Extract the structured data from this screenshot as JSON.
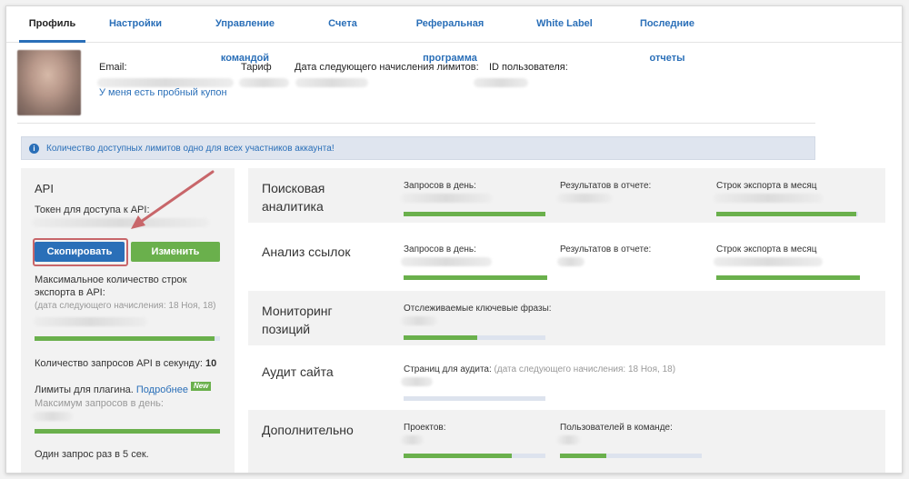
{
  "tabs": [
    {
      "label": "Профиль",
      "active": true
    },
    {
      "label": "Настройки"
    },
    {
      "label": "Управление командой"
    },
    {
      "label": "Счета"
    },
    {
      "label": "Реферальная программа"
    },
    {
      "label": "White Label"
    },
    {
      "label": "Последние отчеты"
    }
  ],
  "profile": {
    "email_label": "Email:",
    "plan_label": "Тариф",
    "next_limits_label": "Дата следующего начисления лимитов:",
    "user_id_label": "ID пользователя:",
    "coupon_link": "У меня есть пробный купон"
  },
  "info": {
    "text": "Количество доступных лимитов одно для всех участников аккаунта!"
  },
  "api": {
    "title": "API",
    "token_label": "Токен для доступа к API:",
    "copy_button": "Скопировать",
    "change_button": "Изменить",
    "max_rows_label_1": "Максимальное количество строк",
    "max_rows_label_2": "экспорта в API:",
    "next_accrual": "(дата следующего начисления: 18 Ноя, 18)",
    "max_rows_progress": 0.97,
    "rps_label": "Количество запросов API в секунду:",
    "rps_value": "10",
    "plugin_label": "Лимиты для плагина.",
    "plugin_link": "Подробнее",
    "plugin_badge": "New",
    "plugin_max_label": "Максимум запросов в день:",
    "plugin_progress": 1.0,
    "rate_text": "Один запрос раз в 5 сек."
  },
  "rows": {
    "search": {
      "title_1": "Поисковая",
      "title_2": "аналитика",
      "c1": "Запросов в день:",
      "c2": "Результатов в отчете:",
      "c3": "Строк экспорта в месяц",
      "p1": 1.0,
      "p3": 0.99
    },
    "links": {
      "title": "Анализ ссылок",
      "c1": "Запросов в день:",
      "c2": "Результатов в отчете:",
      "c3": "Строк экспорта в месяц",
      "p1": 1.0,
      "p3": 1.0
    },
    "positions": {
      "title_1": "Мониторинг",
      "title_2": "позиций",
      "c1": "Отслеживаемые ключевые фразы:",
      "p1": 0.52
    },
    "audit": {
      "title": "Аудит сайта",
      "c1": "Страниц для аудита:",
      "c1_note": "(дата следующего начисления: 18 Ноя, 18)",
      "p1": 0.0
    },
    "extra": {
      "title": "Дополнительно",
      "c1": "Проектов:",
      "c2": "Пользователей в команде:",
      "p1": 0.76,
      "p2": 0.33
    }
  },
  "colors": {
    "accent": "#2a6fb8",
    "green": "#6ab04c",
    "arrow": "#c8666a"
  }
}
